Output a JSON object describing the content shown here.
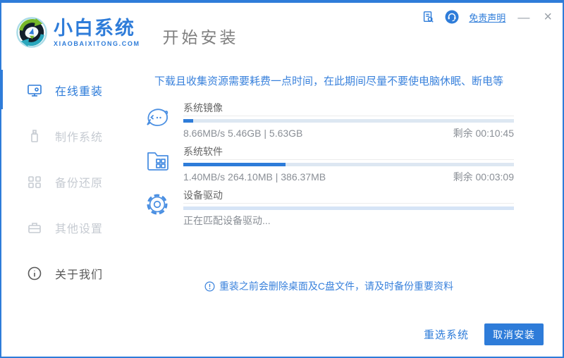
{
  "colors": {
    "accent": "#2e7cd9",
    "progress_track": "#dde7f2",
    "waiting_track": "#d6e4f6",
    "notice_blue": "#3a82dc"
  },
  "header": {
    "brand_name": "小白系统",
    "brand_domain": "XIAOBAIXITONG.COM",
    "page_title": "开始安装",
    "disclaimer": "免责声明",
    "minimize": "—",
    "close": "×"
  },
  "sidebar": {
    "items": [
      {
        "label": "在线重装",
        "icon": "monitor-reinstall-icon",
        "state": "active"
      },
      {
        "label": "制作系统",
        "icon": "usb-drive-icon",
        "state": "disabled"
      },
      {
        "label": "备份还原",
        "icon": "backup-restore-icon",
        "state": "disabled"
      },
      {
        "label": "其他设置",
        "icon": "toolbox-icon",
        "state": "disabled"
      },
      {
        "label": "关于我们",
        "icon": "info-icon",
        "state": "normal"
      }
    ]
  },
  "main": {
    "notice": "下载且收集资源需要耗费一点时间，在此期间尽量不要使电脑休眠、断电等",
    "tasks": [
      {
        "name": "系统镜像",
        "icon": "mascot-face-icon",
        "progress_percent": 3,
        "status_left": "8.66MB/s 5.46GB | 5.63GB",
        "status_right": "剩余 00:10:45"
      },
      {
        "name": "系统软件",
        "icon": "folder-apps-icon",
        "progress_percent": 31,
        "status_left": "1.40MB/s 264.10MB | 386.37MB",
        "status_right": "剩余 00:03:09"
      },
      {
        "name": "设备驱动",
        "icon": "gear-icon",
        "progress_percent": 0,
        "status_left": "正在匹配设备驱动..."
      }
    ],
    "warning": "重装之前会删除桌面及C盘文件，请及时备份重要资料"
  },
  "footer": {
    "reselect": "重选系统",
    "cancel": "取消安装"
  }
}
